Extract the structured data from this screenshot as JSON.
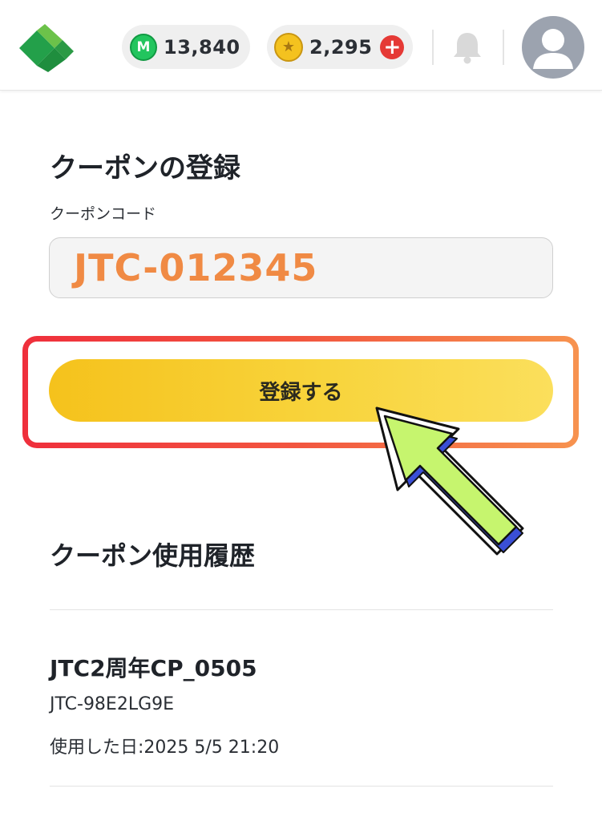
{
  "header": {
    "logo": "leaf-logo",
    "m_points": {
      "icon": "m-point-icon",
      "icon_letter": "M",
      "value": "13,840"
    },
    "coins": {
      "icon": "star-coin-icon",
      "value": "2,295",
      "add_icon": "plus-icon",
      "add_symbol": "+"
    },
    "notification_icon": "bell-icon",
    "avatar_icon": "user-avatar-icon"
  },
  "coupon_register": {
    "title": "クーポンの登録",
    "code_label": "クーポンコード",
    "code_value": "JTC-012345",
    "submit_label": "登録する"
  },
  "annotation": {
    "highlight_color_start": "#ef2f3c",
    "highlight_color_end": "#f7934f",
    "arrow_color": "#c6f56e"
  },
  "history": {
    "title": "クーポン使用履歴",
    "items": [
      {
        "name": "JTC2周年CP_0505",
        "code": "JTC-98E2LG9E",
        "used_date": "使用した日:2025 5/5 21:20"
      }
    ]
  },
  "colors": {
    "button_yellow": "#f8d43c",
    "code_text_orange": "#f08a44",
    "m_green": "#22c55e",
    "add_red": "#e53935"
  }
}
